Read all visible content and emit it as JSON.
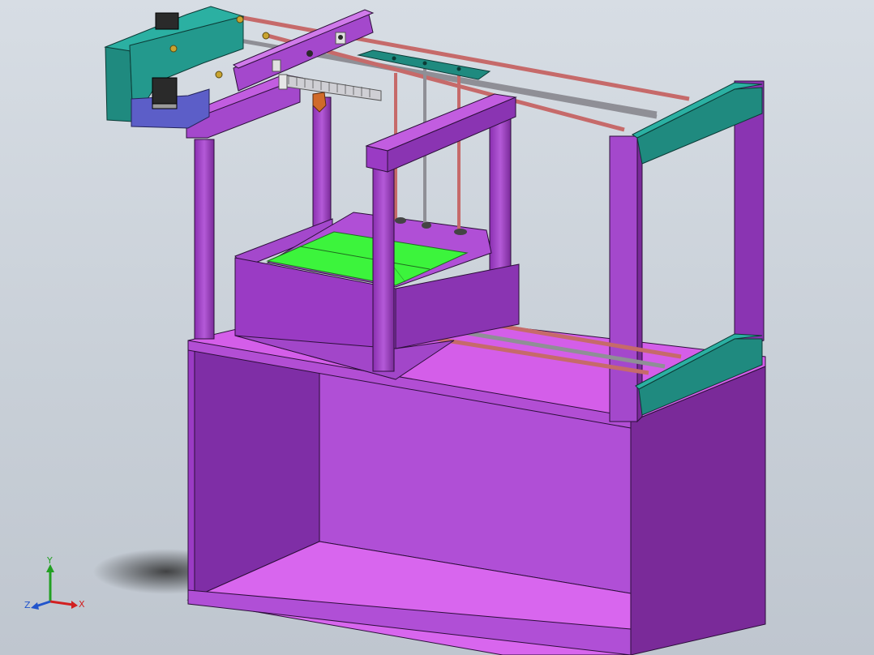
{
  "viewport": {
    "background": "#c9d0d8"
  },
  "model": {
    "colors": {
      "frame_purple": "#b04fd6",
      "frame_purple_dark": "#7a2a99",
      "frame_magenta": "#c25de0",
      "floor_magenta": "#d866ee",
      "teal": "#1f8a7f",
      "teal_dark": "#136058",
      "platform_green": "#3cf43c",
      "rod_red": "#c66a6a",
      "rod_gray": "#8f8f96",
      "motor_blue": "#5c5ec8",
      "motor_black": "#2a2a2a"
    }
  },
  "triad": {
    "x_label": "X",
    "y_label": "Y",
    "z_label": "Z",
    "x_color": "#d22020",
    "y_color": "#22a022",
    "z_color": "#2255cc"
  }
}
